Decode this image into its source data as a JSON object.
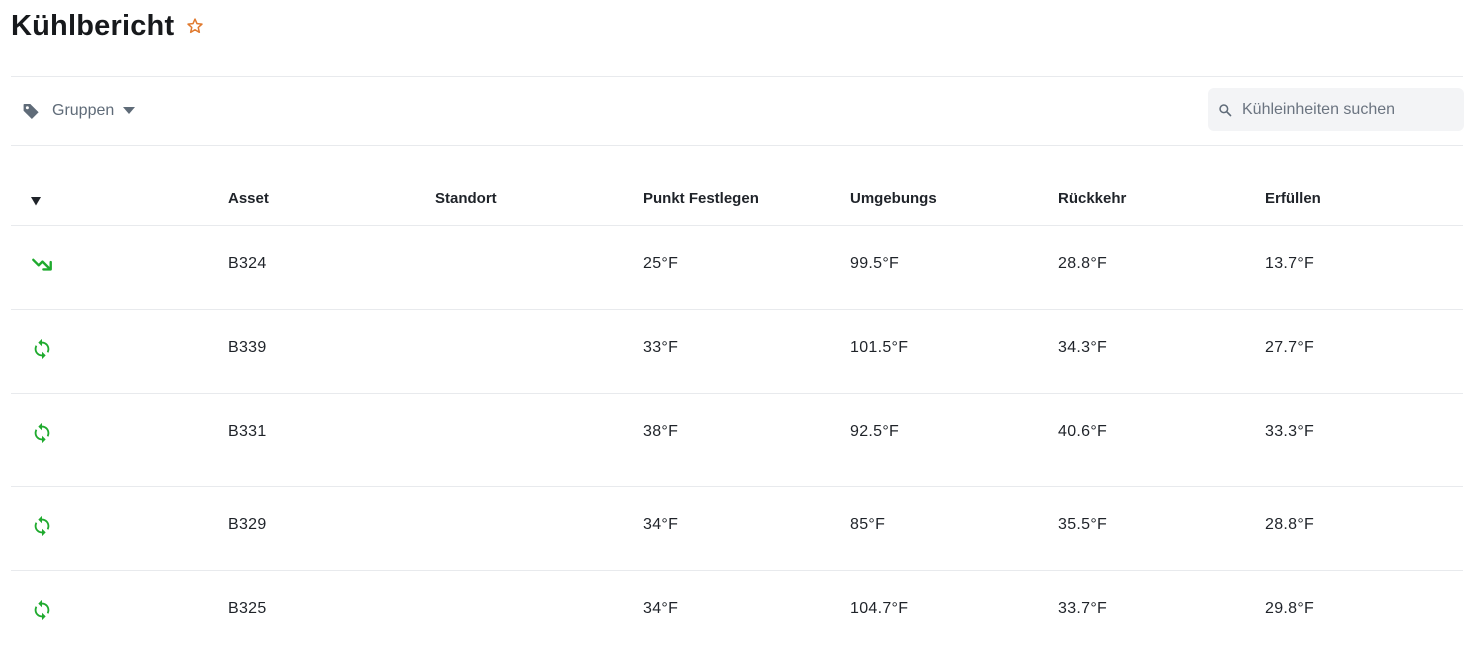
{
  "page": {
    "title": "Kühlbericht",
    "accent_color": "#e07a2f",
    "status_color": "#1faa2e"
  },
  "toolbar": {
    "groups_label": "Gruppen",
    "groups_icon": "tag-icon",
    "search_placeholder": "Kühleinheiten suchen"
  },
  "table": {
    "columns": [
      "Asset",
      "Standort",
      "Punkt Festlegen",
      "Umgebungs",
      "Rückkehr",
      "Erfüllen"
    ],
    "sort_icon": "caret-down-icon",
    "rows": [
      {
        "status_icon": "trending-icon",
        "asset": "B324",
        "location": "",
        "setpoint": "25°F",
        "ambient": "99.5°F",
        "return": "28.8°F",
        "supply": "13.7°F"
      },
      {
        "status_icon": "sync-icon",
        "asset": "B339",
        "location": "",
        "setpoint": "33°F",
        "ambient": "101.5°F",
        "return": "34.3°F",
        "supply": "27.7°F"
      },
      {
        "status_icon": "sync-icon",
        "asset": "B331",
        "location": "",
        "setpoint": "38°F",
        "ambient": "92.5°F",
        "return": "40.6°F",
        "supply": "33.3°F"
      },
      {
        "status_icon": "sync-icon",
        "asset": "B329",
        "location": "",
        "setpoint": "34°F",
        "ambient": "85°F",
        "return": "35.5°F",
        "supply": "28.8°F"
      },
      {
        "status_icon": "sync-icon",
        "asset": "B325",
        "location": "",
        "setpoint": "34°F",
        "ambient": "104.7°F",
        "return": "33.7°F",
        "supply": "29.8°F"
      }
    ]
  }
}
